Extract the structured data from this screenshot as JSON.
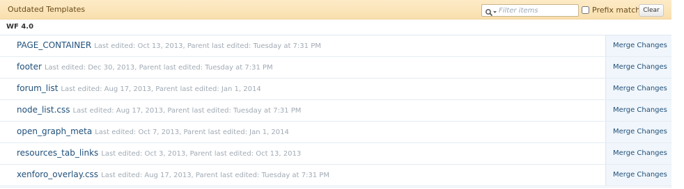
{
  "header": {
    "title": "Outdated Templates",
    "filter_placeholder": "Filter items",
    "prefix_label": "Prefix match",
    "clear_label": "Clear"
  },
  "group": {
    "title": "WF 4.0"
  },
  "rows": [
    {
      "name": "PAGE_CONTAINER",
      "meta": "Last edited: Oct 13, 2013, Parent last edited: Tuesday at 7:31 PM",
      "action": "Merge Changes"
    },
    {
      "name": "footer",
      "meta": "Last edited: Dec 30, 2013, Parent last edited: Tuesday at 7:31 PM",
      "action": "Merge Changes"
    },
    {
      "name": "forum_list",
      "meta": "Last edited: Aug 17, 2013, Parent last edited: Jan 1, 2014",
      "action": "Merge Changes"
    },
    {
      "name": "node_list.css",
      "meta": "Last edited: Aug 17, 2013, Parent last edited: Tuesday at 7:31 PM",
      "action": "Merge Changes"
    },
    {
      "name": "open_graph_meta",
      "meta": "Last edited: Oct 7, 2013, Parent last edited: Jan 1, 2014",
      "action": "Merge Changes"
    },
    {
      "name": "resources_tab_links",
      "meta": "Last edited: Oct 3, 2013, Parent last edited: Oct 13, 2013",
      "action": "Merge Changes"
    },
    {
      "name": "xenforo_overlay.css",
      "meta": "Last edited: Aug 17, 2013, Parent last edited: Tuesday at 7:31 PM",
      "action": "Merge Changes"
    }
  ],
  "colors": {
    "header_bg": "#fbe5bb",
    "link": "#1f4f7a",
    "meta_text": "#a0aab4",
    "action_bg": "#f0f6fb"
  },
  "icons": {
    "filter": "search-dropdown-icon"
  }
}
